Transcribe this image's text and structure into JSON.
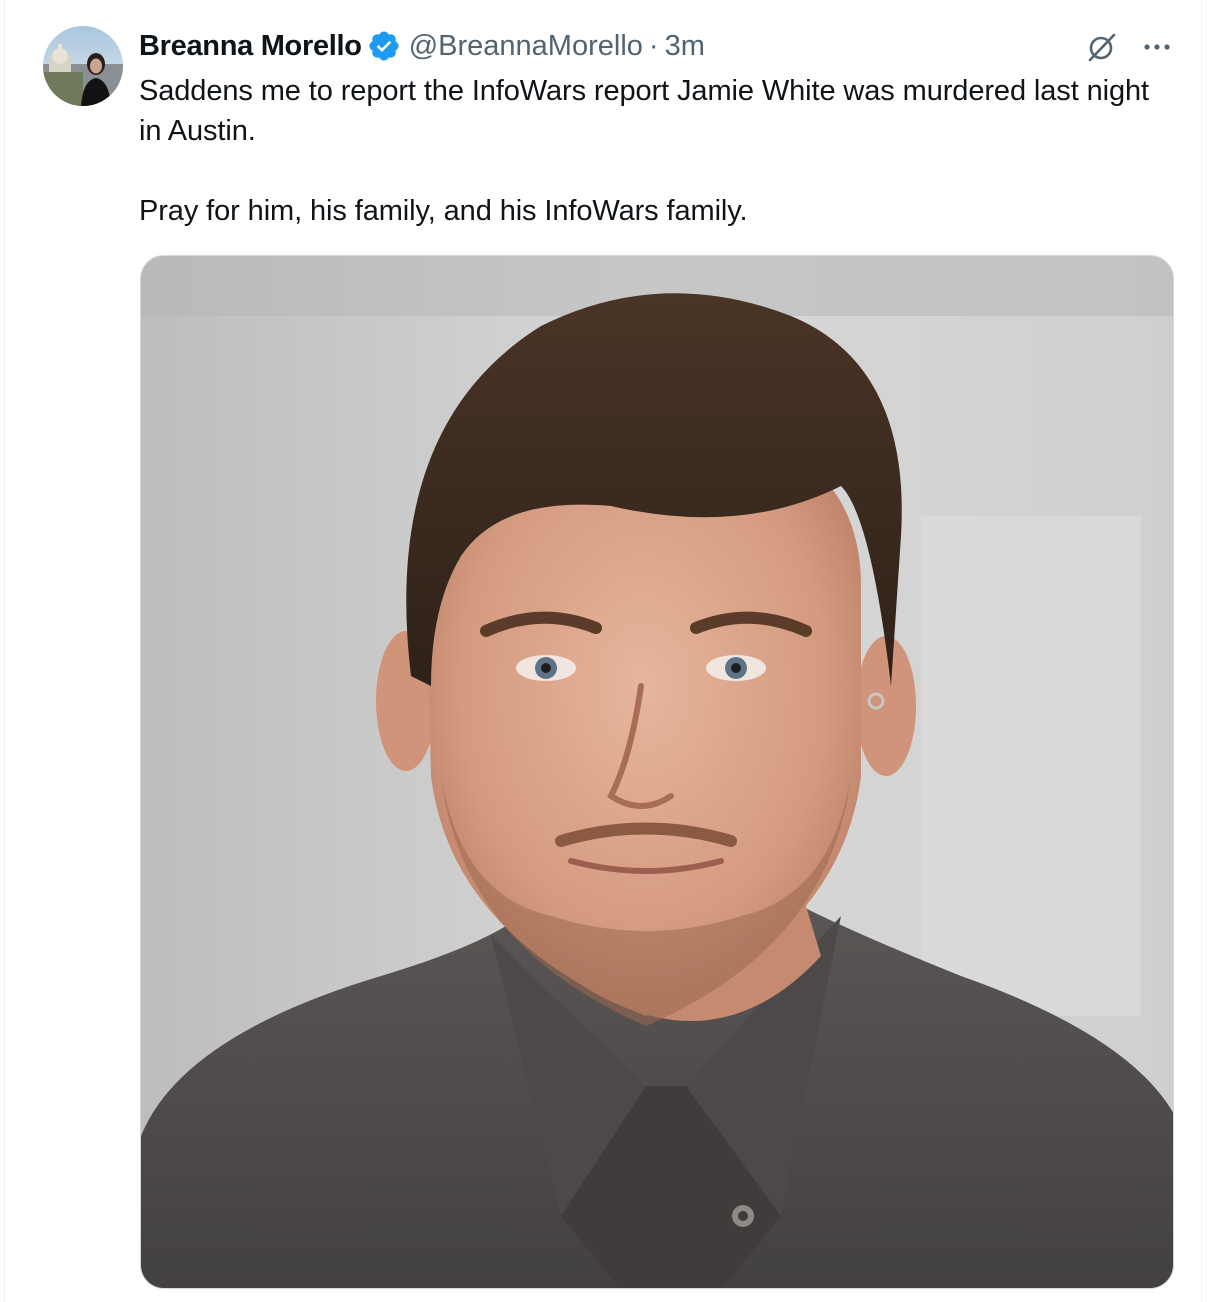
{
  "tweet": {
    "author": {
      "display_name": "Breanna Morello",
      "handle": "@BreannaMorello",
      "verified": true,
      "avatar_icon": "avatar-photo"
    },
    "separator": "·",
    "timestamp": "3m",
    "text_lines": [
      "Saddens me to report the InfoWars report Jamie White was murdered last night in Austin.",
      "Pray for him, his family, and his InfoWars family."
    ],
    "media": {
      "kind": "photo",
      "description_icon": "portrait-photo"
    },
    "actions": {
      "grok_icon": "grok-icon",
      "more_icon": "more-options-icon"
    }
  },
  "colors": {
    "text_primary": "#0f1419",
    "text_secondary": "#536471",
    "verified_blue": "#1d9bf0",
    "border": "#cfd9de"
  }
}
